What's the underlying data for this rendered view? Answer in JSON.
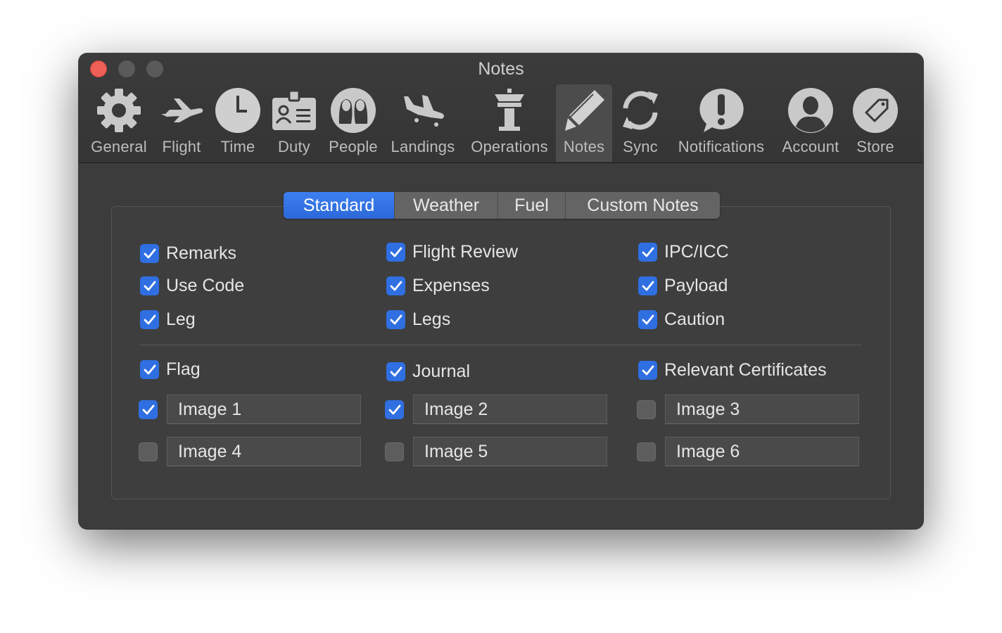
{
  "window": {
    "title": "Notes"
  },
  "toolbar": {
    "items": [
      {
        "label": "General",
        "icon": "gear-icon"
      },
      {
        "label": "Flight",
        "icon": "airplane-icon"
      },
      {
        "label": "Time",
        "icon": "clock-icon"
      },
      {
        "label": "Duty",
        "icon": "id-badge-icon"
      },
      {
        "label": "People",
        "icon": "people-icon"
      },
      {
        "label": "Landings",
        "icon": "landing-icon"
      },
      {
        "label": "Operations",
        "icon": "control-tower-icon"
      },
      {
        "label": "Notes",
        "icon": "pencil-icon",
        "active": true
      },
      {
        "label": "Sync",
        "icon": "sync-icon"
      },
      {
        "label": "Notifications",
        "icon": "exclamation-bubble-icon"
      },
      {
        "label": "Account",
        "icon": "person-icon"
      },
      {
        "label": "Store",
        "icon": "tag-icon"
      }
    ]
  },
  "tabs": {
    "items": [
      "Standard",
      "Weather",
      "Fuel",
      "Custom Notes"
    ],
    "selected": "Standard"
  },
  "options": [
    {
      "label": "Remarks",
      "checked": true
    },
    {
      "label": "Flight Review",
      "checked": true
    },
    {
      "label": "IPC/ICC",
      "checked": true
    },
    {
      "label": "Use Code",
      "checked": true
    },
    {
      "label": "Expenses",
      "checked": true
    },
    {
      "label": "Payload",
      "checked": true
    },
    {
      "label": "Leg",
      "checked": true
    },
    {
      "label": "Legs",
      "checked": true
    },
    {
      "label": "Caution",
      "checked": true
    },
    {
      "label": "Flag",
      "checked": true
    },
    {
      "label": "Journal",
      "checked": true
    },
    {
      "label": "Relevant Certificates",
      "checked": true
    }
  ],
  "images": [
    {
      "value": "Image 1",
      "checked": true
    },
    {
      "value": "Image 2",
      "checked": true
    },
    {
      "value": "Image 3",
      "checked": false
    },
    {
      "value": "Image 4",
      "checked": false
    },
    {
      "value": "Image 5",
      "checked": false
    },
    {
      "value": "Image 6",
      "checked": false
    }
  ],
  "colors": {
    "accent": "#2f6fe2",
    "window_bg": "#3c3c3c",
    "close_button": "#ed5f57"
  }
}
